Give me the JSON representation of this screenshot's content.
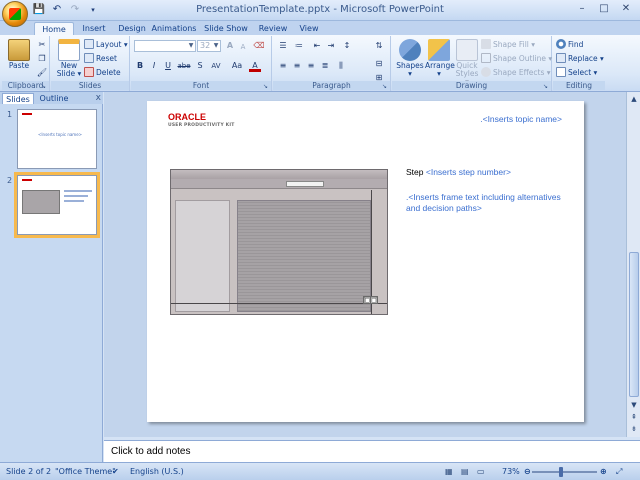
{
  "window": {
    "title": "PresentationTemplate.pptx - Microsoft PowerPoint",
    "qat_icons": [
      "save-icon",
      "undo-icon",
      "redo-icon",
      "customize-qat-icon"
    ],
    "controls": [
      "–",
      "□",
      "✕"
    ]
  },
  "tabs": [
    "Home",
    "Insert",
    "Design",
    "Animations",
    "Slide Show",
    "Review",
    "View"
  ],
  "active_tab": "Home",
  "ribbon": {
    "clipboard": {
      "label": "Clipboard",
      "paste": "Paste"
    },
    "slides": {
      "label": "Slides",
      "new_slide_line1": "New",
      "new_slide_line2": "Slide",
      "layout": "Layout",
      "reset": "Reset",
      "delete": "Delete"
    },
    "font": {
      "label": "Font",
      "font_name": "",
      "font_size": "32",
      "bold": "B",
      "italic": "I",
      "underline": "U",
      "strike": "abe",
      "shadow": "S",
      "spacing": "AV",
      "case": "Aa",
      "color": "A",
      "grow": "A",
      "shrink": "A"
    },
    "paragraph": {
      "label": "Paragraph"
    },
    "drawing": {
      "label": "Drawing",
      "shapes": "Shapes",
      "arrange": "Arrange",
      "quick_styles_line1": "Quick",
      "quick_styles_line2": "Styles",
      "shape_fill": "Shape Fill",
      "shape_outline": "Shape Outline",
      "shape_effects": "Shape Effects"
    },
    "editing": {
      "label": "Editing",
      "find": "Find",
      "replace": "Replace",
      "select": "Select"
    }
  },
  "left_pane": {
    "tabs": [
      "Slides",
      "Outline"
    ],
    "close": "x",
    "thumbnails": [
      {
        "number": "1",
        "text": "<Inserts topic name>"
      },
      {
        "number": "2",
        "text": ""
      }
    ]
  },
  "slide": {
    "logo_main": "ORACLE",
    "logo_sub": "USER PRODUCTIVITY KIT",
    "topic": ".<Inserts topic name>",
    "step_label": "Step",
    "step_placeholder": "<Inserts step number>",
    "frame_text": ".<Inserts frame text including alternatives and decision paths>"
  },
  "notes": {
    "placeholder": "Click to add notes"
  },
  "status": {
    "slide_info": "Slide 2 of 2",
    "theme": "\"Office Theme\"",
    "language": "English (U.S.)",
    "zoom": "73%",
    "zoom_fraction": 0.45
  },
  "colors": {
    "accent": "#15428b",
    "placeholder_blue": "#3b6fd0",
    "selected_thumb": "#f7b94d",
    "oracle_red": "#cc0000"
  }
}
